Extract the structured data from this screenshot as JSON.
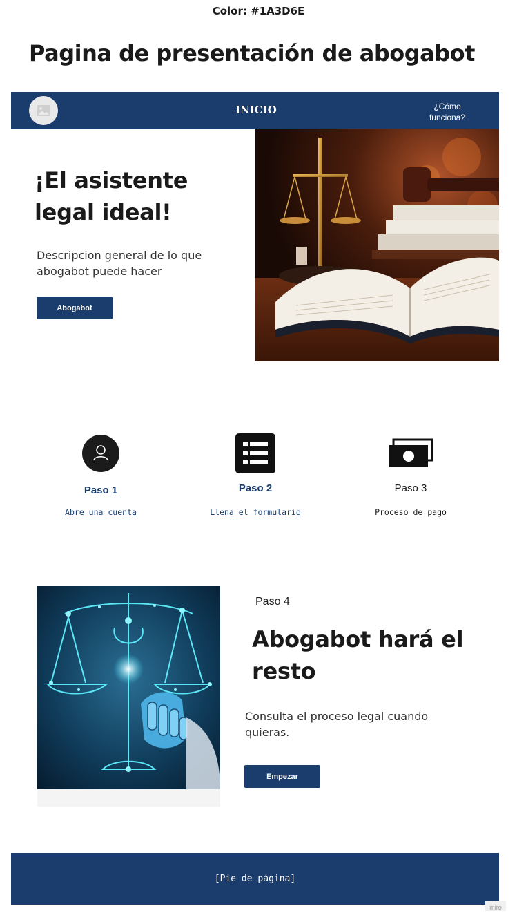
{
  "header": {
    "color_note": "Color: #1A3D6E",
    "page_title": "Pagina de presentación de abogabot"
  },
  "colors": {
    "brand": "#1A3D6E"
  },
  "nav": {
    "logo_icon": "image-placeholder-icon",
    "home": "INICIO",
    "how_it_works": "¿Cómo funciona?"
  },
  "hero": {
    "heading": "¡El asistente legal ideal!",
    "description": "Descripcion general de lo que abogabot puede hacer",
    "button": "Abogabot",
    "image": "scales-of-justice-books-gavel"
  },
  "steps": [
    {
      "icon": "user-icon",
      "title": "Paso 1",
      "link": "Abre una cuenta"
    },
    {
      "icon": "list-icon",
      "title": "Paso 2",
      "link": "Llena el formulario"
    },
    {
      "icon": "money-icon",
      "title": "Paso 3",
      "link": "Proceso de pago"
    }
  ],
  "step4": {
    "label": "Paso 4",
    "heading": "Abogabot hará el resto",
    "description": "Consulta el proceso legal cuando quieras.",
    "button": "Empezar",
    "image": "robot-hand-digital-scales"
  },
  "footer": {
    "text": "[Pie de página]"
  },
  "watermark": "miro"
}
